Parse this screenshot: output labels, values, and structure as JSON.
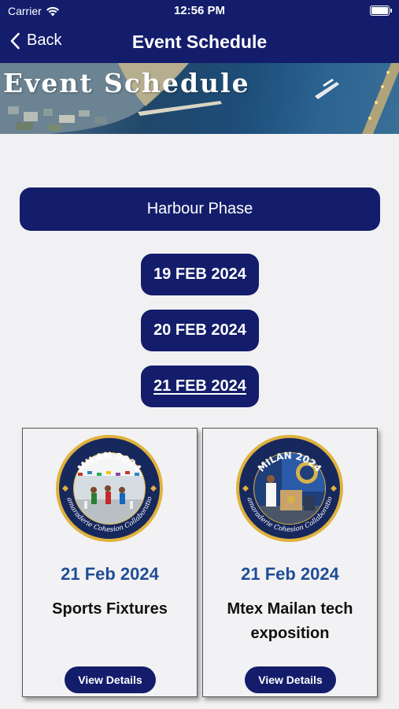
{
  "status_bar": {
    "carrier": "Carrier",
    "time": "12:56 PM"
  },
  "nav": {
    "back_label": "Back",
    "title": "Event Schedule"
  },
  "banner": {
    "title": "Event Schedule"
  },
  "phase": {
    "label": "Harbour Phase"
  },
  "dates": [
    {
      "label": "19 FEB 2024",
      "selected": false
    },
    {
      "label": "20 FEB 2024",
      "selected": false
    },
    {
      "label": "21 FEB 2024",
      "selected": true
    }
  ],
  "logo": {
    "top_text": "MILAN 2024",
    "ring_text": "Camaraderie Cohesion Collaboration"
  },
  "cards": [
    {
      "date": "21 Feb 2024",
      "title": "Sports Fixtures",
      "button": "View Details"
    },
    {
      "date": "21 Feb 2024",
      "title": "Mtex Mailan tech exposition",
      "button": "View Details"
    }
  ],
  "colors": {
    "navy": "#131d6b",
    "date_text": "#1f4e96",
    "background": "#f1f1f3",
    "logo_gold": "#d8a733"
  }
}
